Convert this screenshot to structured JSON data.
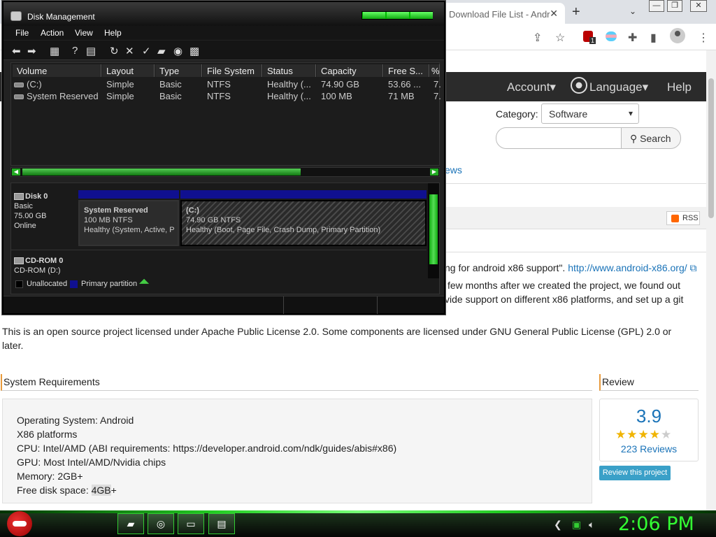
{
  "browser": {
    "tab_title": "Download File List - Andr",
    "tab_close": "✕",
    "new_tab": "+",
    "tab_chevron": "⌄",
    "win_min": "—",
    "win_max": "❐",
    "win_close": "✕",
    "ext_badge_count": "1"
  },
  "site": {
    "nav": {
      "account": "Account▾",
      "language": "Language▾",
      "help": "Help"
    },
    "category_label": "Category:",
    "category_value": "Software",
    "search_button": "Search",
    "reviews_link_fragment": "ews",
    "rss_label": "RSS",
    "desc_line1_tail": "ng for android x86 support\".",
    "desc_link": "http://www.android-x86.org/",
    "desc_line2_tail": "few months after we created the project, we found out",
    "desc_line3_tail": "vide support on different x86 platforms, and set up a git",
    "license_line1": "This is an open source project licensed under Apache Public License 2.0. Some components are licensed under GNU General Public License (GPL) 2.0 or",
    "license_line2": "later.",
    "sysreq_title": "System Requirements",
    "review_title": "Review",
    "requirements": [
      "Operating System: Android",
      "X86 platforms",
      "CPU: Intel/AMD (ABI requirements: https://developer.android.com/ndk/guides/abis#x86)",
      "GPU: Most Intel/AMD/Nvidia chips",
      "Memory: 2GB+"
    ],
    "free_disk_prefix": "Free disk space: ",
    "free_disk_value": "4GB",
    "free_disk_suffix": "+",
    "rating": "3.9",
    "stars_full": "★★★★",
    "stars_empty": "★",
    "reviews_count": "223 Reviews",
    "review_button": "Review this project"
  },
  "disk_mgmt": {
    "title": "Disk Management",
    "menu": [
      "File",
      "Action",
      "View",
      "Help"
    ],
    "columns": [
      "Volume",
      "Layout",
      "Type",
      "File System",
      "Status",
      "Capacity",
      "Free S...",
      "%"
    ],
    "rows": [
      [
        "(C:)",
        "Simple",
        "Basic",
        "NTFS",
        "Healthy (...",
        "74.90 GB",
        "53.66 ...",
        "7."
      ],
      [
        "System Reserved",
        "Simple",
        "Basic",
        "NTFS",
        "Healthy (...",
        "100 MB",
        "71 MB",
        "7."
      ]
    ],
    "disk0": {
      "name": "Disk 0",
      "type": "Basic",
      "size": "75.00 GB",
      "state": "Online"
    },
    "sys_reserved": {
      "name": "System Reserved",
      "fs": "100 MB NTFS",
      "status": "Healthy (System, Active, P"
    },
    "c_drive": {
      "name": "(C:)",
      "fs": "74.90 GB NTFS",
      "status": "Healthy (Boot, Page File, Crash Dump, Primary Partition)"
    },
    "cdrom": {
      "name": "CD-ROM 0",
      "drive": "CD-ROM (D:)"
    },
    "legend_unallocated": "Unallocated",
    "legend_primary": "Primary partition",
    "colors": {
      "unallocated": "#000000",
      "primary": "#101090"
    }
  },
  "taskbar": {
    "clock": "2:06 PM",
    "accent": "#33ff33"
  }
}
